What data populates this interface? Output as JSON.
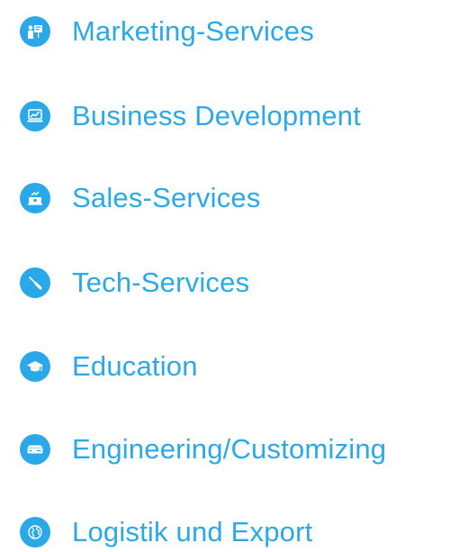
{
  "colors": {
    "accent": "#2aa8e8",
    "icon_glyph": "#ffffff"
  },
  "services": [
    {
      "label": "Marketing-Services",
      "icon": "presentation-board-icon"
    },
    {
      "label": "Business Development",
      "icon": "growth-chart-laptop-icon"
    },
    {
      "label": "Sales-Services",
      "icon": "cash-register-icon"
    },
    {
      "label": "Tech-Services",
      "icon": "screwdriver-icon"
    },
    {
      "label": "Education",
      "icon": "graduation-cap-icon"
    },
    {
      "label": "Engineering/Customizing",
      "icon": "server-box-icon"
    },
    {
      "label": "Logistik und Export",
      "icon": "globe-icon"
    }
  ]
}
